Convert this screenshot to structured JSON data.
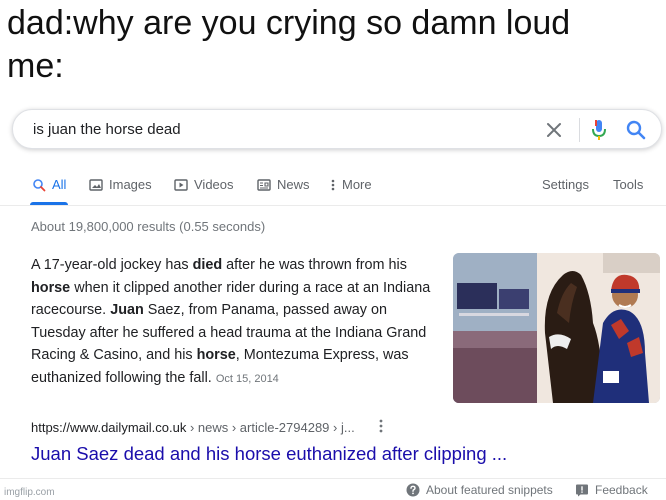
{
  "caption": {
    "line1": "dad:why are you crying so damn loud",
    "line2": "me:"
  },
  "search": {
    "query": "is juan the horse dead"
  },
  "tabs": [
    {
      "label": "All",
      "icon": "search-icon",
      "active": true
    },
    {
      "label": "Images",
      "icon": "image-icon"
    },
    {
      "label": "Videos",
      "icon": "play-icon"
    },
    {
      "label": "News",
      "icon": "news-icon"
    },
    {
      "label": "More",
      "icon": "more-dots-icon"
    },
    {
      "label": "Settings"
    },
    {
      "label": "Tools"
    }
  ],
  "stats": "About 19,800,000 results (0.55 seconds)",
  "snippet": {
    "t1": "A 17-year-old jockey has ",
    "b1": "died",
    "t2": " after he was thrown from his ",
    "b2": "horse",
    "t3": " when it clipped another rider during a race at an Indiana racecourse. ",
    "b3": "Juan",
    "t4": " Saez, from Panama, passed away on Tuesday after he suffered a head trauma at the Indiana Grand Racing & Casino, and his ",
    "b4": "horse",
    "t5": ", Montezuma Express, was euthanized following the fall.",
    "date": "Oct 15, 2014"
  },
  "result": {
    "url": "https://www.dailymail.co.uk",
    "breadcrumb": " › news › article-2794289 › j...",
    "title": "Juan Saez dead and his horse euthanized after clipping ..."
  },
  "footer": {
    "about": "About featured snippets",
    "feedback": "Feedback",
    "watermark": "imgflip.com"
  },
  "colors": {
    "accent": "#1a73e8",
    "link": "#1a0dab",
    "mic_red": "#ea4335"
  }
}
